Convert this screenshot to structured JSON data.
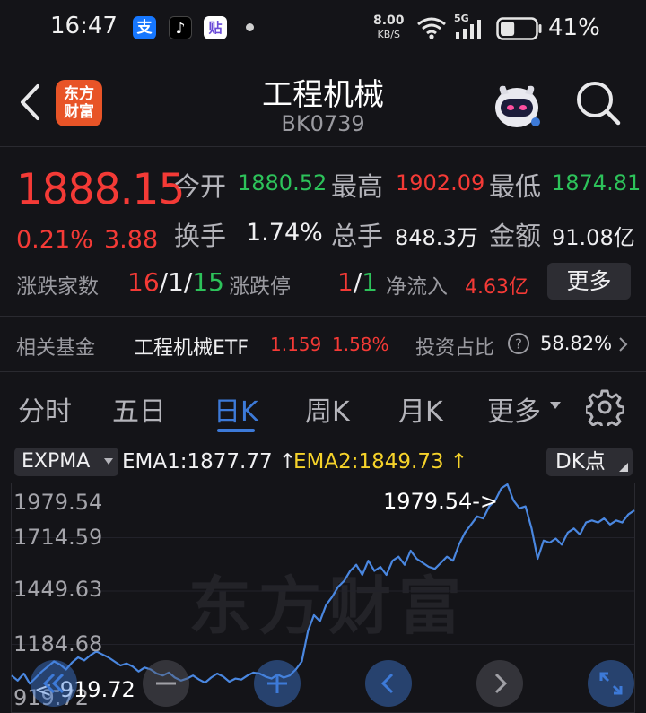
{
  "status_bar": {
    "time": "16:47",
    "apps": [
      {
        "icon": "alipay-icon",
        "glyph": "支",
        "color": "#1677ff"
      },
      {
        "icon": "tiktok-icon",
        "glyph": "♪",
        "color": "#111111"
      },
      {
        "icon": "tie-icon",
        "glyph": "贴",
        "color": "#6b4bd8"
      }
    ],
    "net_speed": "8.00",
    "net_unit": "KB/S",
    "network_type": "5G",
    "battery_pct": "41%",
    "battery_level": 0.41
  },
  "header": {
    "logo_line1": "东方",
    "logo_line2": "财富",
    "title": "工程机械",
    "code": "BK0739"
  },
  "quote": {
    "price": "1888.15",
    "change_pct": "0.21%",
    "change_amt": "3.88",
    "open_label": "今开",
    "open_value": "1880.52",
    "high_label": "最高",
    "high_value": "1902.09",
    "low_label": "最低",
    "low_value": "1874.81",
    "turnover_label": "换手",
    "turnover_value": "1.74%",
    "volume_label": "总手",
    "volume_value": "848.3万",
    "amount_label": "金额",
    "amount_value": "91.08亿",
    "updown_label": "涨跌家数",
    "up_count": "16",
    "flat_count": "1",
    "down_count": "15",
    "limit_label": "涨跌停",
    "limit_up": "1",
    "limit_down": "1",
    "inflow_label": "净流入",
    "inflow_value": "4.63亿",
    "more_button": "更多"
  },
  "fund": {
    "label": "相关基金",
    "name": "工程机械ETF",
    "price": "1.159",
    "pct": "1.58%",
    "ratio_label": "投资占比",
    "ratio_value": "58.82%"
  },
  "tabs": [
    {
      "label": "分时",
      "active": false
    },
    {
      "label": "五日",
      "active": false
    },
    {
      "label": "日K",
      "active": true
    },
    {
      "label": "周K",
      "active": false
    },
    {
      "label": "月K",
      "active": false
    },
    {
      "label": "更多",
      "active": false
    }
  ],
  "chart": {
    "indicator": "EXPMA",
    "ema1": "EMA1:1877.77",
    "ema2": "EMA2:1849.73",
    "dk_label": "DK点",
    "watermark": "东方财富",
    "y_ticks": [
      "1979.54",
      "1714.59",
      "1449.63",
      "1184.68",
      "919.72"
    ],
    "max_annotation": "1979.54->",
    "min_annotation": "<-919.72",
    "colors": {
      "line": "#4a87e0",
      "ema2": "#f5d22a",
      "up": "#f43a36",
      "down": "#2dc25a"
    }
  },
  "chart_data": {
    "type": "line",
    "title": "",
    "xlabel": "",
    "ylabel": "",
    "ylim": [
      919.72,
      1979.54
    ],
    "max_point": 1979.54,
    "min_point": 919.72,
    "series": [
      {
        "values": [
          1030,
          1005,
          1040,
          990,
          1020,
          1050,
          1075,
          1100,
          1085,
          1060,
          1095,
          1120,
          1105,
          1130,
          1150,
          1135,
          1120,
          1100,
          1080,
          1090,
          1075,
          1050,
          1070,
          1060,
          1040,
          1030,
          1045,
          1020,
          1005,
          1015,
          1030,
          1010,
          995,
          1020,
          1040,
          1025,
          1000,
          1015,
          1010,
          1030,
          1045,
          1040,
          1025,
          1015,
          1035,
          1020,
          1030,
          1060,
          1100,
          1250,
          1330,
          1300,
          1380,
          1420,
          1470,
          1500,
          1550,
          1580,
          1530,
          1600,
          1550,
          1570,
          1530,
          1600,
          1620,
          1580,
          1650,
          1610,
          1590,
          1570,
          1560,
          1590,
          1620,
          1600,
          1680,
          1740,
          1780,
          1820,
          1810,
          1870,
          1900,
          1960,
          1979.54,
          1900,
          1860,
          1870,
          1760,
          1610,
          1700,
          1690,
          1710,
          1680,
          1740,
          1760,
          1730,
          1790,
          1800,
          1790,
          1810,
          1780,
          1800,
          1790,
          1830,
          1850
        ]
      }
    ]
  }
}
